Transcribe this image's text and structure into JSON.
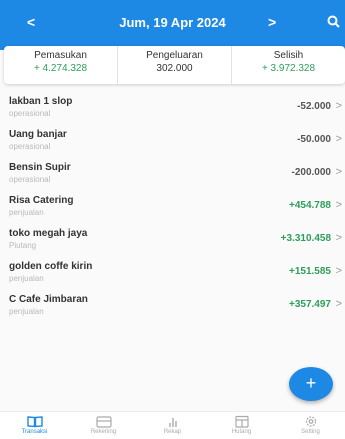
{
  "header": {
    "date": "Jum, 19 Apr 2024",
    "prev_label": "<",
    "next_label": ">",
    "search_icon": "search-icon"
  },
  "summary": {
    "income_label": "Pemasukan",
    "income_value": "+ 4.274.328",
    "expense_label": "Pengeluaran",
    "expense_value": "302.000",
    "diff_label": "Selisih",
    "diff_value": "+ 3.972.328"
  },
  "transactions": [
    {
      "title": "lakban 1 slop",
      "category": "operasional",
      "amount": "-52.000"
    },
    {
      "title": "Uang banjar",
      "category": "operasional",
      "amount": "-50.000"
    },
    {
      "title": "Bensin Supir",
      "category": "operasional",
      "amount": "-200.000"
    },
    {
      "title": "Risa Catering",
      "category": "penjualan",
      "amount": "+454.788"
    },
    {
      "title": "toko megah jaya",
      "category": "Piutang",
      "amount": "+3.310.458"
    },
    {
      "title": "golden coffe kirin",
      "category": "penjualan",
      "amount": "+151.585"
    },
    {
      "title": "C Cafe Jimbaran",
      "category": "penjualan",
      "amount": "+357.497"
    }
  ],
  "chevron": ">",
  "fab_label": "+",
  "nav": [
    {
      "label": "Transaksi",
      "icon": "book-icon",
      "active": true
    },
    {
      "label": "Rekening",
      "icon": "wallet-icon",
      "active": false
    },
    {
      "label": "Rekap",
      "icon": "bar-chart-icon",
      "active": false
    },
    {
      "label": "Hutang",
      "icon": "ledger-icon",
      "active": false
    },
    {
      "label": "Setting",
      "icon": "gear-icon",
      "active": false
    }
  ],
  "colors": {
    "primary": "#1e88e5",
    "positive": "#2e9e5b",
    "negative": "#555555"
  }
}
